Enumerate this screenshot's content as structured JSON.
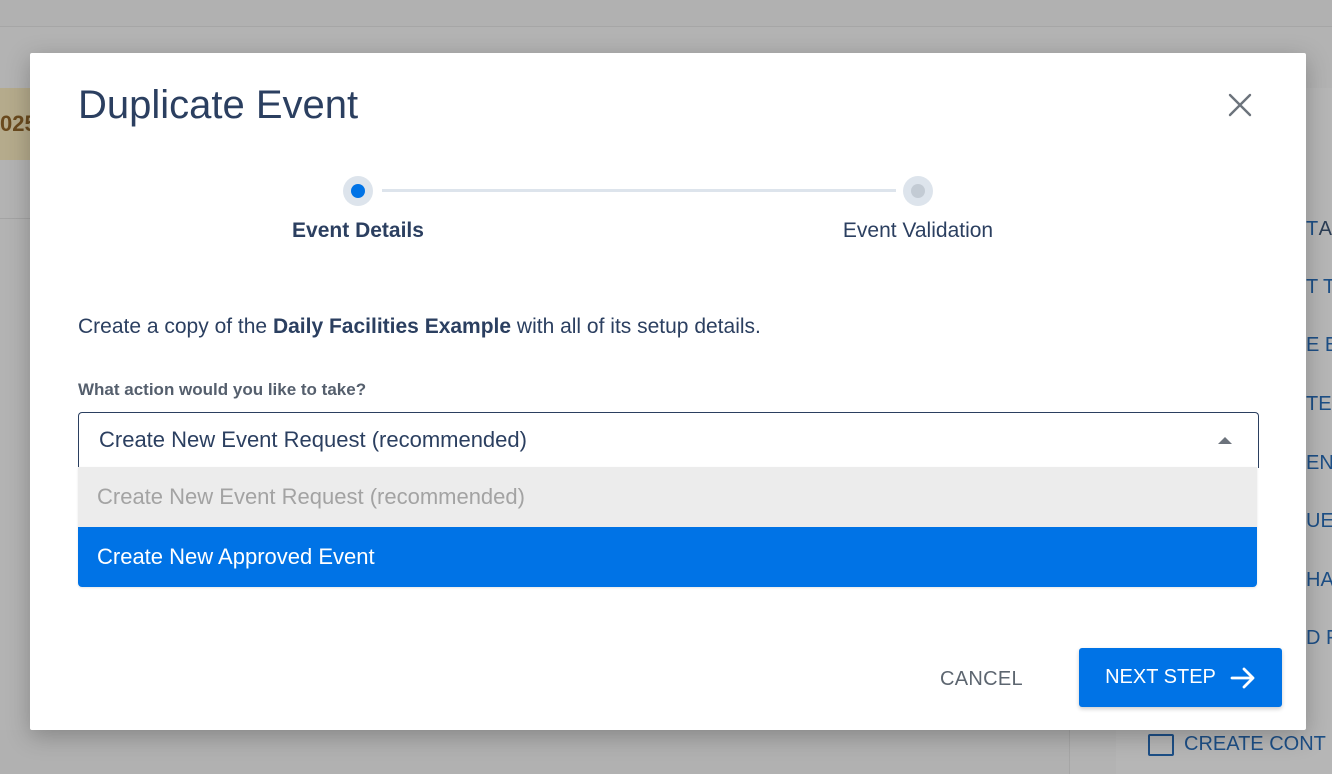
{
  "background": {
    "date_fragment": "025",
    "right_panel_letter": "A",
    "right_items": [
      "T",
      "T TY",
      "E EV",
      "TEN",
      "ENT",
      "UES",
      "HA",
      "D F"
    ],
    "create_link_label": "CREATE CONT"
  },
  "modal": {
    "title": "Duplicate Event",
    "close_icon": "close-icon",
    "steps": [
      {
        "label": "Event Details",
        "active": true
      },
      {
        "label": "Event Validation",
        "active": false
      }
    ],
    "intro": {
      "prefix": "Create a copy of the ",
      "event_name": "Daily Facilities Example",
      "suffix": " with all of its setup details."
    },
    "field_label": "What action would you like to take?",
    "select": {
      "value": "Create New Event Request (recommended)",
      "options": [
        {
          "label": "Create New Event Request (recommended)",
          "state": "disabled"
        },
        {
          "label": "Create New Approved Event",
          "state": "highlighted"
        }
      ]
    },
    "cancel_label": "CANCEL",
    "next_label": "NEXT STEP",
    "next_icon": "arrow-right-icon"
  },
  "colors": {
    "primary": "#0073e6",
    "heading": "#2b3f60",
    "step_inactive": "#dde4ec"
  }
}
